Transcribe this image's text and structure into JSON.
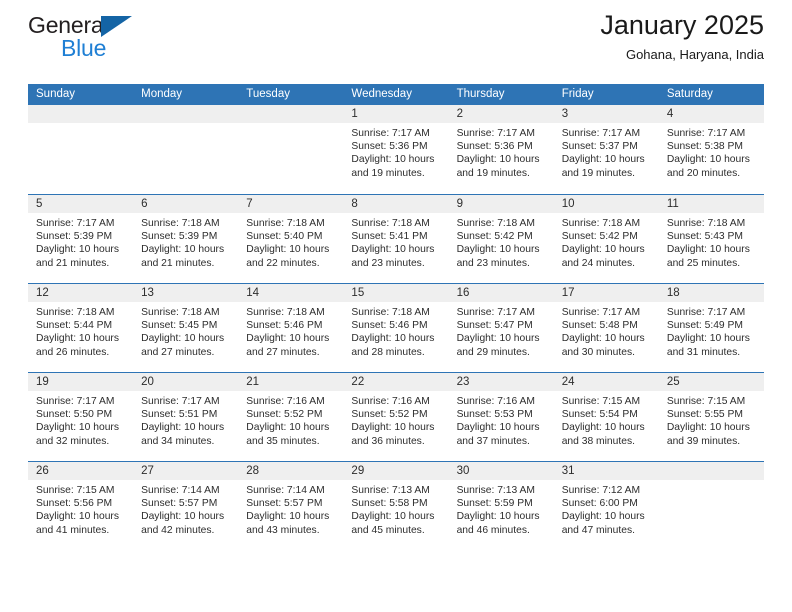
{
  "brand": {
    "word_one": "General",
    "word_two": "Blue",
    "triangle_icon": "triangle-logo-icon"
  },
  "header": {
    "title": "January 2025",
    "location": "Gohana, Haryana, India"
  },
  "calendar": {
    "weekday_headers": [
      "Sunday",
      "Monday",
      "Tuesday",
      "Wednesday",
      "Thursday",
      "Friday",
      "Saturday"
    ],
    "labels": {
      "sunrise": "Sunrise:",
      "sunset": "Sunset:",
      "daylight": "Daylight:"
    },
    "weeks": [
      [
        {
          "day": "",
          "empty": true
        },
        {
          "day": "",
          "empty": true
        },
        {
          "day": "",
          "empty": true
        },
        {
          "day": "1",
          "sunrise": "Sunrise: 7:17 AM",
          "sunset": "Sunset: 5:36 PM",
          "daylight_1": "Daylight: 10 hours",
          "daylight_2": "and 19 minutes."
        },
        {
          "day": "2",
          "sunrise": "Sunrise: 7:17 AM",
          "sunset": "Sunset: 5:36 PM",
          "daylight_1": "Daylight: 10 hours",
          "daylight_2": "and 19 minutes."
        },
        {
          "day": "3",
          "sunrise": "Sunrise: 7:17 AM",
          "sunset": "Sunset: 5:37 PM",
          "daylight_1": "Daylight: 10 hours",
          "daylight_2": "and 19 minutes."
        },
        {
          "day": "4",
          "sunrise": "Sunrise: 7:17 AM",
          "sunset": "Sunset: 5:38 PM",
          "daylight_1": "Daylight: 10 hours",
          "daylight_2": "and 20 minutes."
        }
      ],
      [
        {
          "day": "5",
          "sunrise": "Sunrise: 7:17 AM",
          "sunset": "Sunset: 5:39 PM",
          "daylight_1": "Daylight: 10 hours",
          "daylight_2": "and 21 minutes."
        },
        {
          "day": "6",
          "sunrise": "Sunrise: 7:18 AM",
          "sunset": "Sunset: 5:39 PM",
          "daylight_1": "Daylight: 10 hours",
          "daylight_2": "and 21 minutes."
        },
        {
          "day": "7",
          "sunrise": "Sunrise: 7:18 AM",
          "sunset": "Sunset: 5:40 PM",
          "daylight_1": "Daylight: 10 hours",
          "daylight_2": "and 22 minutes."
        },
        {
          "day": "8",
          "sunrise": "Sunrise: 7:18 AM",
          "sunset": "Sunset: 5:41 PM",
          "daylight_1": "Daylight: 10 hours",
          "daylight_2": "and 23 minutes."
        },
        {
          "day": "9",
          "sunrise": "Sunrise: 7:18 AM",
          "sunset": "Sunset: 5:42 PM",
          "daylight_1": "Daylight: 10 hours",
          "daylight_2": "and 23 minutes."
        },
        {
          "day": "10",
          "sunrise": "Sunrise: 7:18 AM",
          "sunset": "Sunset: 5:42 PM",
          "daylight_1": "Daylight: 10 hours",
          "daylight_2": "and 24 minutes."
        },
        {
          "day": "11",
          "sunrise": "Sunrise: 7:18 AM",
          "sunset": "Sunset: 5:43 PM",
          "daylight_1": "Daylight: 10 hours",
          "daylight_2": "and 25 minutes."
        }
      ],
      [
        {
          "day": "12",
          "sunrise": "Sunrise: 7:18 AM",
          "sunset": "Sunset: 5:44 PM",
          "daylight_1": "Daylight: 10 hours",
          "daylight_2": "and 26 minutes."
        },
        {
          "day": "13",
          "sunrise": "Sunrise: 7:18 AM",
          "sunset": "Sunset: 5:45 PM",
          "daylight_1": "Daylight: 10 hours",
          "daylight_2": "and 27 minutes."
        },
        {
          "day": "14",
          "sunrise": "Sunrise: 7:18 AM",
          "sunset": "Sunset: 5:46 PM",
          "daylight_1": "Daylight: 10 hours",
          "daylight_2": "and 27 minutes."
        },
        {
          "day": "15",
          "sunrise": "Sunrise: 7:18 AM",
          "sunset": "Sunset: 5:46 PM",
          "daylight_1": "Daylight: 10 hours",
          "daylight_2": "and 28 minutes."
        },
        {
          "day": "16",
          "sunrise": "Sunrise: 7:17 AM",
          "sunset": "Sunset: 5:47 PM",
          "daylight_1": "Daylight: 10 hours",
          "daylight_2": "and 29 minutes."
        },
        {
          "day": "17",
          "sunrise": "Sunrise: 7:17 AM",
          "sunset": "Sunset: 5:48 PM",
          "daylight_1": "Daylight: 10 hours",
          "daylight_2": "and 30 minutes."
        },
        {
          "day": "18",
          "sunrise": "Sunrise: 7:17 AM",
          "sunset": "Sunset: 5:49 PM",
          "daylight_1": "Daylight: 10 hours",
          "daylight_2": "and 31 minutes."
        }
      ],
      [
        {
          "day": "19",
          "sunrise": "Sunrise: 7:17 AM",
          "sunset": "Sunset: 5:50 PM",
          "daylight_1": "Daylight: 10 hours",
          "daylight_2": "and 32 minutes."
        },
        {
          "day": "20",
          "sunrise": "Sunrise: 7:17 AM",
          "sunset": "Sunset: 5:51 PM",
          "daylight_1": "Daylight: 10 hours",
          "daylight_2": "and 34 minutes."
        },
        {
          "day": "21",
          "sunrise": "Sunrise: 7:16 AM",
          "sunset": "Sunset: 5:52 PM",
          "daylight_1": "Daylight: 10 hours",
          "daylight_2": "and 35 minutes."
        },
        {
          "day": "22",
          "sunrise": "Sunrise: 7:16 AM",
          "sunset": "Sunset: 5:52 PM",
          "daylight_1": "Daylight: 10 hours",
          "daylight_2": "and 36 minutes."
        },
        {
          "day": "23",
          "sunrise": "Sunrise: 7:16 AM",
          "sunset": "Sunset: 5:53 PM",
          "daylight_1": "Daylight: 10 hours",
          "daylight_2": "and 37 minutes."
        },
        {
          "day": "24",
          "sunrise": "Sunrise: 7:15 AM",
          "sunset": "Sunset: 5:54 PM",
          "daylight_1": "Daylight: 10 hours",
          "daylight_2": "and 38 minutes."
        },
        {
          "day": "25",
          "sunrise": "Sunrise: 7:15 AM",
          "sunset": "Sunset: 5:55 PM",
          "daylight_1": "Daylight: 10 hours",
          "daylight_2": "and 39 minutes."
        }
      ],
      [
        {
          "day": "26",
          "sunrise": "Sunrise: 7:15 AM",
          "sunset": "Sunset: 5:56 PM",
          "daylight_1": "Daylight: 10 hours",
          "daylight_2": "and 41 minutes."
        },
        {
          "day": "27",
          "sunrise": "Sunrise: 7:14 AM",
          "sunset": "Sunset: 5:57 PM",
          "daylight_1": "Daylight: 10 hours",
          "daylight_2": "and 42 minutes."
        },
        {
          "day": "28",
          "sunrise": "Sunrise: 7:14 AM",
          "sunset": "Sunset: 5:57 PM",
          "daylight_1": "Daylight: 10 hours",
          "daylight_2": "and 43 minutes."
        },
        {
          "day": "29",
          "sunrise": "Sunrise: 7:13 AM",
          "sunset": "Sunset: 5:58 PM",
          "daylight_1": "Daylight: 10 hours",
          "daylight_2": "and 45 minutes."
        },
        {
          "day": "30",
          "sunrise": "Sunrise: 7:13 AM",
          "sunset": "Sunset: 5:59 PM",
          "daylight_1": "Daylight: 10 hours",
          "daylight_2": "and 46 minutes."
        },
        {
          "day": "31",
          "sunrise": "Sunrise: 7:12 AM",
          "sunset": "Sunset: 6:00 PM",
          "daylight_1": "Daylight: 10 hours",
          "daylight_2": "and 47 minutes."
        },
        {
          "day": "",
          "empty": true
        }
      ]
    ]
  },
  "colors": {
    "header_blue": "#2e74b5",
    "brand_blue": "#1f7fd4",
    "brand_triangle": "#1464a5",
    "daynum_band": "#efefef",
    "text": "#2d2d2d"
  }
}
